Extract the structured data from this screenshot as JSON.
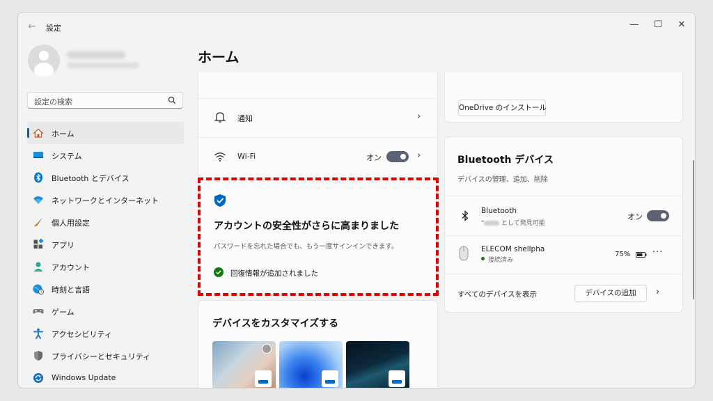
{
  "app": {
    "title": "設定",
    "back": "←",
    "minimize": "—",
    "maximize": "☐",
    "close": "✕"
  },
  "search": {
    "placeholder": "設定の検索"
  },
  "sidebar": {
    "items": [
      {
        "label": "ホーム",
        "icon": "home-icon",
        "active": true
      },
      {
        "label": "システム",
        "icon": "system-icon"
      },
      {
        "label": "Bluetooth とデバイス",
        "icon": "bluetooth-icon"
      },
      {
        "label": "ネットワークとインターネット",
        "icon": "network-icon"
      },
      {
        "label": "個人用設定",
        "icon": "brush-icon"
      },
      {
        "label": "アプリ",
        "icon": "apps-icon"
      },
      {
        "label": "アカウント",
        "icon": "account-icon"
      },
      {
        "label": "時刻と言語",
        "icon": "clock-globe-icon"
      },
      {
        "label": "ゲーム",
        "icon": "gamepad-icon"
      },
      {
        "label": "アクセシビリティ",
        "icon": "accessibility-icon"
      },
      {
        "label": "プライバシーとセキュリティ",
        "icon": "shield-icon"
      },
      {
        "label": "Windows Update",
        "icon": "windows-update-icon"
      }
    ]
  },
  "main": {
    "title": "ホーム",
    "notifications": {
      "label": "通知"
    },
    "wifi": {
      "label": "Wi-Fi",
      "state": "オン"
    },
    "security": {
      "title": "アカウントの安全性がさらに高まりました",
      "description": "パスワードを忘れた場合でも、もう一度サインインできます。",
      "status": "回復情報が追加されました"
    },
    "customize": {
      "title": "デバイスをカスタマイズする"
    },
    "onedrive": {
      "button": "OneDrive のインストール"
    },
    "bluetooth": {
      "title": "Bluetooth デバイス",
      "subtitle": "デバイスの管理、追加、削除",
      "bt_label": "Bluetooth",
      "bt_sub_quote": "\"",
      "bt_sub": " として発見可能",
      "bt_state": "オン",
      "device_name": "ELECOM shellpha",
      "device_status": "接続済み",
      "battery": "75%",
      "more": "···",
      "view_all": "すべてのデバイスを表示",
      "add_button": "デバイスの追加"
    }
  },
  "colors": {
    "accent": "#005fb8",
    "highlight": "#e00000",
    "toggle": "#5a6273",
    "connected": "#0f7b0f"
  }
}
